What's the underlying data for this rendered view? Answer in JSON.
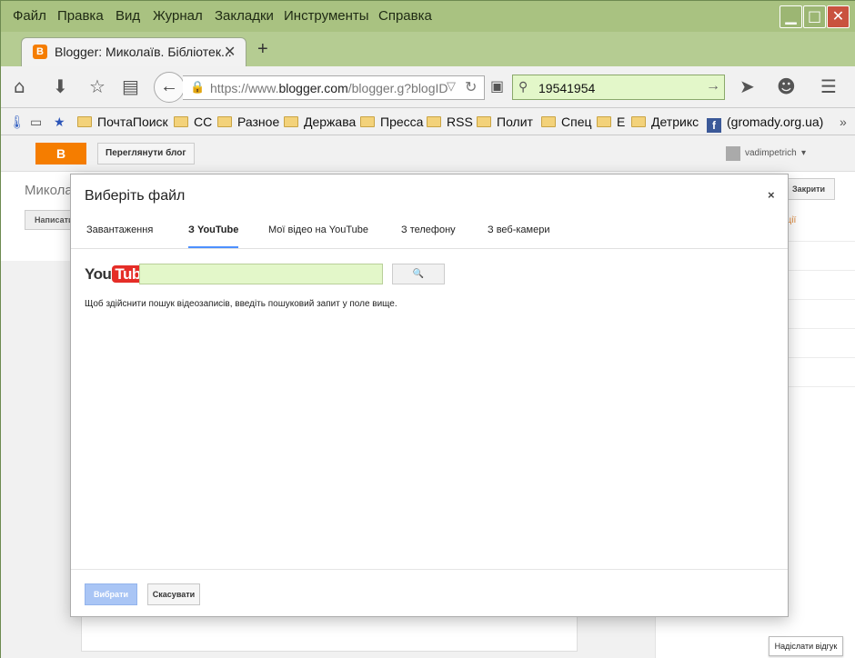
{
  "menu": {
    "items": [
      "Файл",
      "Правка",
      "Вид",
      "Журнал",
      "Закладки",
      "Инструменты",
      "Справка"
    ],
    "underlined": [
      "Ф",
      "П",
      "В",
      "Ж",
      "З",
      "И",
      "С"
    ]
  },
  "tab": {
    "title": "Blogger: Миколаїв. Бібліотек...",
    "favicon": "B"
  },
  "nav": {
    "url_prefix": "https://www.",
    "url_domain": "blogger.com",
    "url_suffix": "/blogger.g?blogID=",
    "search_value": "19541954"
  },
  "bookmarks": [
    {
      "label": "ПочтаПоиск",
      "icon": "folder-icon"
    },
    {
      "label": "СС",
      "icon": "folder-icon"
    },
    {
      "label": "Разное",
      "icon": "folder-icon"
    },
    {
      "label": "Держава",
      "icon": "folder-icon"
    },
    {
      "label": "Пресса",
      "icon": "folder-icon"
    },
    {
      "label": "RSS",
      "icon": "folder-icon"
    },
    {
      "label": "Полит",
      "icon": "folder-icon"
    },
    {
      "label": "Спец",
      "icon": "folder-icon"
    },
    {
      "label": "Е",
      "icon": "folder-icon"
    },
    {
      "label": "Детрикс",
      "icon": "folder-icon"
    },
    {
      "label": "(gromady.org.ua)",
      "icon": "facebook-icon"
    }
  ],
  "blogger": {
    "view_blog": "Переглянути блог",
    "user": "vadimpetrich",
    "title": "Миколаї",
    "write": "Написати",
    "close": "Закрити",
    "side_link": "ації",
    "feedback": "Надіслати відгук"
  },
  "dialog": {
    "title": "Виберіть файл",
    "close": "×",
    "tabs": [
      "Завантаження",
      "З YouTube",
      "Мої відео на YouTube",
      "З телефону",
      "З веб-камери"
    ],
    "active_tab": "З YouTube",
    "yt_logo_you": "You",
    "yt_logo_tube": "Tube",
    "search_value": "",
    "hint": "Щоб здійснити пошук відеозаписів, введіть пошуковий запит у поле вище.",
    "choose": "Вибрати",
    "cancel": "Скасувати"
  },
  "colors": {
    "accent": "#4d90fe",
    "blogger_orange": "#f57d00",
    "window_frame": "#b5cc92"
  }
}
